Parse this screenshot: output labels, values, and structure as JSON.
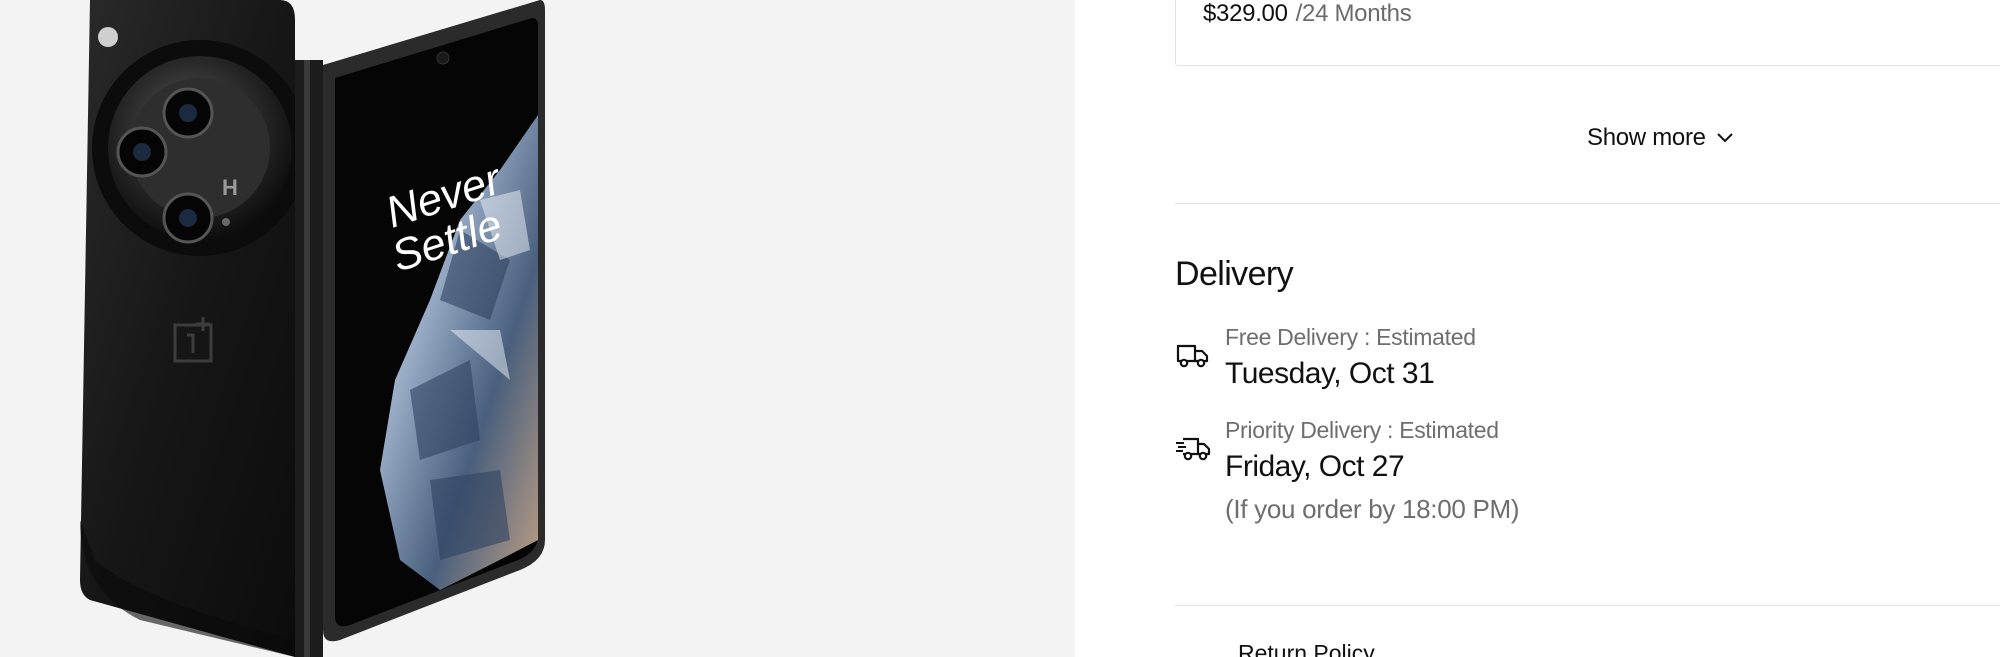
{
  "plan": {
    "price": "$329.00",
    "term": "/24 Months"
  },
  "show_more": {
    "label": "Show more",
    "icon": "chevron-down-icon"
  },
  "delivery": {
    "title": "Delivery",
    "options": [
      {
        "icon": "truck-icon",
        "label": "Free Delivery : Estimated",
        "date": "Tuesday, Oct 31",
        "note": ""
      },
      {
        "icon": "fast-truck-icon",
        "label": "Priority Delivery : Estimated",
        "date": "Friday, Oct 27",
        "note": "(If you order by 18:00 PM)"
      }
    ]
  },
  "return_policy": {
    "label": "Return Policy"
  },
  "product_image": {
    "screen_text_line1": "Never",
    "screen_text_line2": "Settle",
    "colors": {
      "body": "#1a1a1a",
      "frame": "#2b2b2b",
      "screen": "#050505",
      "crystal": "#9fb4cf"
    }
  }
}
